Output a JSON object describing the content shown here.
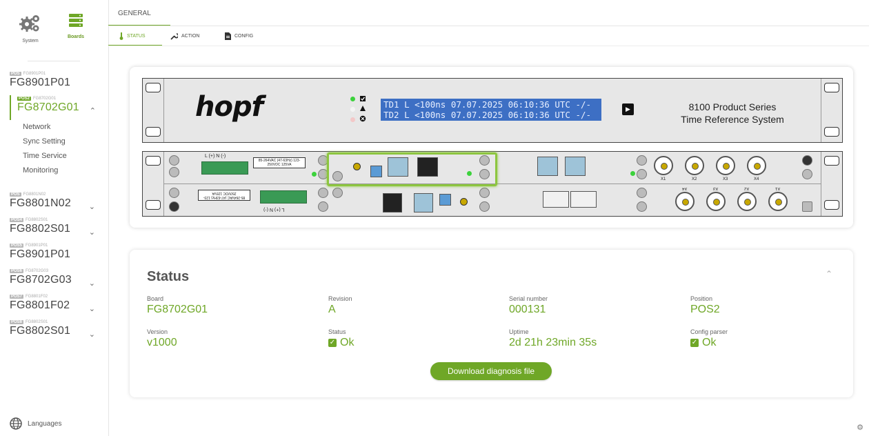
{
  "sidebar": {
    "top": {
      "system_label": "System",
      "boards_label": "Boards"
    },
    "boards": [
      {
        "tag": "POS",
        "small": "FG8901P01",
        "name": "FG8901P01",
        "active": false
      },
      {
        "tag": "POS2",
        "small": "FG8702G01",
        "name": "FG8702G01",
        "active": true
      },
      {
        "tag": "POS",
        "small": "FG8801N02",
        "name": "FG8801N02",
        "active": false
      },
      {
        "tag": "POS4",
        "small": "FG8802S01",
        "name": "FG8802S01",
        "active": false
      },
      {
        "tag": "POS5",
        "small": "FG8901P01",
        "name": "FG8901P01",
        "active": false
      },
      {
        "tag": "POS6",
        "small": "FG8702G03",
        "name": "FG8702G03",
        "active": false
      },
      {
        "tag": "POS7",
        "small": "FG8801F02",
        "name": "FG8801F02",
        "active": false
      },
      {
        "tag": "POS8",
        "small": "FG8802S01",
        "name": "FG8802S01",
        "active": false
      }
    ],
    "submenu": [
      "Network",
      "Sync Setting",
      "Time Service",
      "Monitoring"
    ],
    "languages_label": "Languages"
  },
  "tabs": {
    "general": "GENERAL",
    "status": "STATUS",
    "action": "ACTION",
    "config": "CONFIG"
  },
  "device": {
    "logo": "hopf",
    "lcd_line1": "TD1 L <100ns 07.07.2025 06:10:36 UTC -/-",
    "lcd_line2": "TD2 L <100ns 07.07.2025 06:10:36 UTC -/-",
    "product_line1": "8100 Product Series",
    "product_line2": "Time Reference System",
    "psu_label": "85-264VAC (47-63Hz) 123-250VDC 125VA",
    "psu_label_b": "85-264VAC (47-63Hz) 123-250VDC 125VA",
    "lmn": "L (+) N (-)",
    "lmn_b": "L (+) N (-)",
    "x_labels": [
      "X1",
      "X2",
      "X3",
      "X4"
    ],
    "x_labels_b": [
      "X4",
      "X3",
      "X2",
      "X1"
    ]
  },
  "status": {
    "title": "Status",
    "fields": {
      "board": {
        "label": "Board",
        "value": "FG8702G01"
      },
      "revision": {
        "label": "Revision",
        "value": "A"
      },
      "serial": {
        "label": "Serial number",
        "value": "000131"
      },
      "position": {
        "label": "Position",
        "value": "POS2"
      },
      "version": {
        "label": "Version",
        "value": "v1000"
      },
      "status": {
        "label": "Status",
        "value": "Ok"
      },
      "uptime": {
        "label": "Uptime",
        "value": "2d 21h 23min 35s"
      },
      "config_parser": {
        "label": "Config parser",
        "value": "Ok"
      }
    },
    "download_label": "Download diagnosis file"
  },
  "colors": {
    "accent": "#6fa727",
    "lcd": "#3d6fc4",
    "highlight": "#8dc63f"
  }
}
